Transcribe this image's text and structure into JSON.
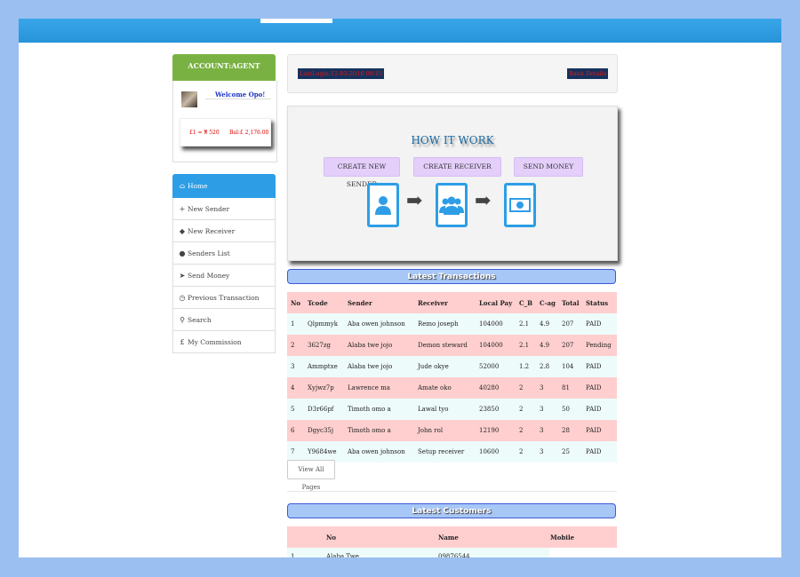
{
  "sidebar": {
    "account_title": "ACCOUNT:AGENT",
    "welcome": "Welcome Opo!",
    "rate": "£1 = ₦ 520",
    "balance": "Bal:£ 2,176.00",
    "nav": [
      {
        "icon": "home-icon",
        "glyph": "⌂",
        "label": "Home"
      },
      {
        "icon": "plus-icon",
        "glyph": "+",
        "label": "New Sender"
      },
      {
        "icon": "tags-icon",
        "glyph": "◆",
        "label": "New Receiver"
      },
      {
        "icon": "user-icon",
        "glyph": "●",
        "label": "Senders List"
      },
      {
        "icon": "send-icon",
        "glyph": "➤",
        "label": "Send Money"
      },
      {
        "icon": "clock-icon",
        "glyph": "◷",
        "label": "Previous Transaction"
      },
      {
        "icon": "search-icon",
        "glyph": "⚲",
        "label": "Search"
      },
      {
        "icon": "pound-icon",
        "glyph": "£",
        "label": "My Commission"
      }
    ]
  },
  "header": {
    "last_login": "LastLogin:12-03-2016 08:12",
    "bank_details": "Bank Details"
  },
  "how_it_works": {
    "title": "HOW IT WORK",
    "steps": [
      "CREATE NEW SENDER",
      "CREATE RECEIVER",
      "SEND MONEY"
    ]
  },
  "transactions": {
    "title": "Latest Transactions",
    "columns": [
      "No",
      "Tcode",
      "Sender",
      "Receiver",
      "Local Pay",
      "C_B",
      "C-ag",
      "Total",
      "Status"
    ],
    "rows": [
      [
        "1",
        "Qlpmmyk",
        "Aba owen johnson",
        "Remo joseph",
        "104000",
        "2.1",
        "4.9",
        "207",
        "PAID"
      ],
      [
        "2",
        "3627zg",
        "Alaba twe jojo",
        "Demon steward",
        "104000",
        "2.1",
        "4.9",
        "207",
        "Pending"
      ],
      [
        "3",
        "Ammptxe",
        "Alaba twe jojo",
        "Jude okye",
        "52000",
        "1.2",
        "2.8",
        "104",
        "PAID"
      ],
      [
        "4",
        "Xyjwz7p",
        "Lawrence ma",
        "Amate oko",
        "40280",
        "2",
        "3",
        "81",
        "PAID"
      ],
      [
        "5",
        "D3r66pf",
        "Timoth omo a",
        "Lawal tyo",
        "23850",
        "2",
        "3",
        "50",
        "PAID"
      ],
      [
        "6",
        "Dgyc35j",
        "Timoth omo a",
        "John rol",
        "12190",
        "2",
        "3",
        "28",
        "PAID"
      ],
      [
        "7",
        "Y9684we",
        "Aba owen johnson",
        "Setup receiver",
        "10600",
        "2",
        "3",
        "25",
        "PAID"
      ]
    ],
    "view_all": "View All Pages"
  },
  "customers": {
    "title": "Latest Customers",
    "columns": [
      "",
      "No",
      "Name",
      "Mobile"
    ],
    "rows": [
      [
        "1",
        "Alaba Twe",
        "09876544",
        ""
      ]
    ]
  }
}
